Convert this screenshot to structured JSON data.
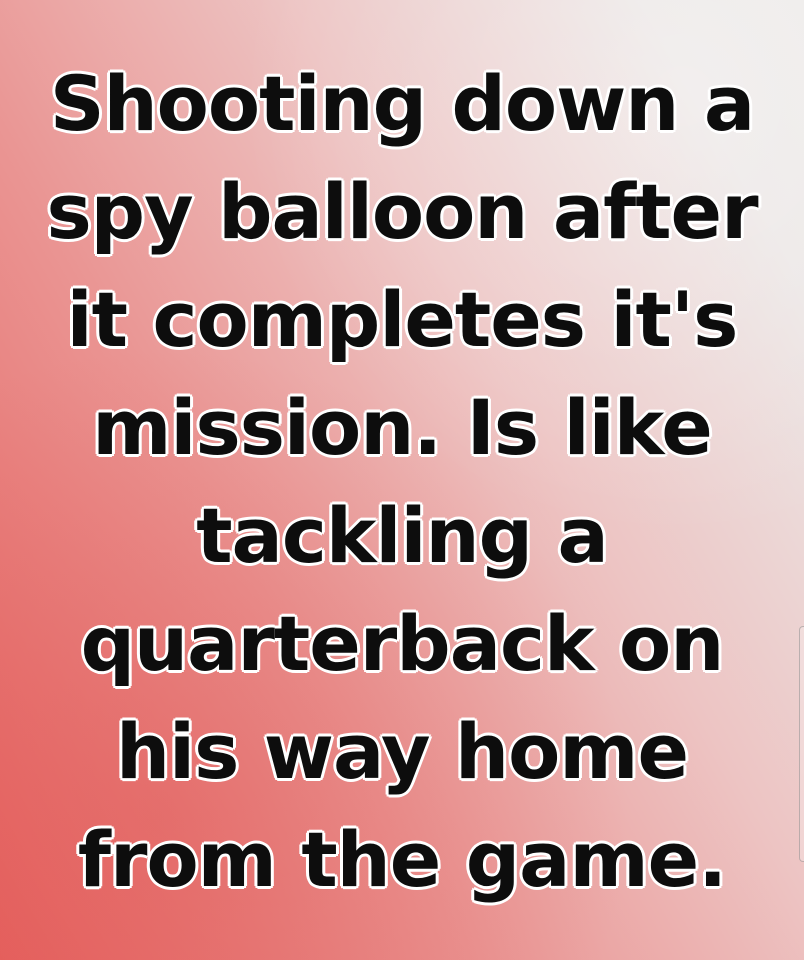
{
  "meme": {
    "lines": [
      "Shooting down a",
      "spy balloon after",
      "it completes it's",
      "mission. Is like",
      "tackling a",
      "quarterback on",
      "his way home",
      "from the game."
    ]
  },
  "colors": {
    "gradient_red": "#e6625f",
    "gradient_pink": "#ea9593",
    "gradient_light": "#ece9e8",
    "text": "#0d0d0d",
    "text_outline": "#ffffff"
  }
}
